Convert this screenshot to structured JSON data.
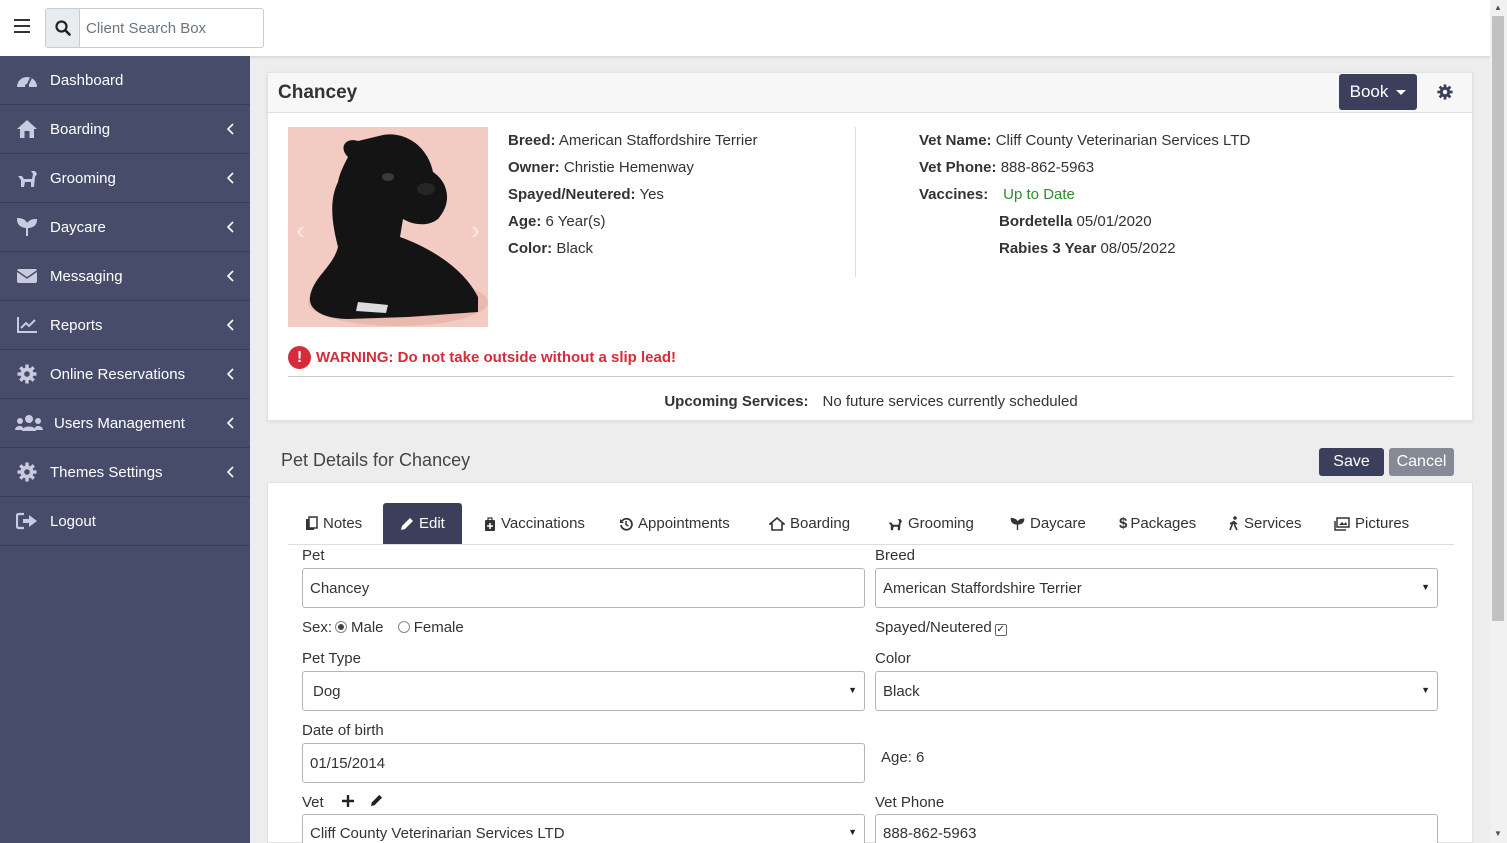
{
  "search": {
    "placeholder": "Client Search Box"
  },
  "sidebar": {
    "items": [
      {
        "label": "Dashboard",
        "icon": "dashboard-icon",
        "has_chevron": false
      },
      {
        "label": "Boarding",
        "icon": "home-icon",
        "has_chevron": true
      },
      {
        "label": "Grooming",
        "icon": "dog-icon",
        "has_chevron": true
      },
      {
        "label": "Daycare",
        "icon": "seedling-icon",
        "has_chevron": true
      },
      {
        "label": "Messaging",
        "icon": "envelope-icon",
        "has_chevron": true
      },
      {
        "label": "Reports",
        "icon": "chart-line-icon",
        "has_chevron": true
      },
      {
        "label": "Online Reservations",
        "icon": "gear-icon",
        "has_chevron": true
      },
      {
        "label": "Users Management",
        "icon": "users-icon",
        "has_chevron": true
      },
      {
        "label": "Themes Settings",
        "icon": "gear-icon",
        "has_chevron": true
      },
      {
        "label": "Logout",
        "icon": "sign-out-icon",
        "has_chevron": false
      }
    ]
  },
  "pet_card": {
    "name": "Chancey",
    "book_label": "Book",
    "breed_label": "Breed:",
    "breed": "American Staffordshire Terrier",
    "owner_label": "Owner:",
    "owner": "Christie Hemenway",
    "spayed_label": "Spayed/Neutered:",
    "spayed": "Yes",
    "age_label": "Age:",
    "age": "6 Year(s)",
    "color_label": "Color:",
    "color": "Black",
    "vet_name_label": "Vet Name:",
    "vet_name": "Cliff County Veterinarian Services LTD",
    "vet_phone_label": "Vet Phone:",
    "vet_phone": "888-862-5963",
    "vaccines_label": "Vaccines:",
    "vaccines_status": "Up to Date",
    "vaccines": [
      {
        "name": "Bordetella",
        "date": "05/01/2020"
      },
      {
        "name": "Rabies 3 Year",
        "date": "08/05/2022"
      }
    ],
    "warning": "WARNING: Do not take outside without a slip lead!",
    "upcoming_label": "Upcoming Services:",
    "upcoming_value": "No future services currently scheduled"
  },
  "details": {
    "title": "Pet Details for Chancey",
    "save_label": "Save",
    "cancel_label": "Cancel",
    "tabs": [
      {
        "label": "Notes",
        "icon": "notes-icon"
      },
      {
        "label": "Edit",
        "icon": "pencil-icon"
      },
      {
        "label": "Vaccinations",
        "icon": "medkit-icon"
      },
      {
        "label": "Appointments",
        "icon": "history-icon"
      },
      {
        "label": "Boarding",
        "icon": "home-icon"
      },
      {
        "label": "Grooming",
        "icon": "dog-icon"
      },
      {
        "label": "Daycare",
        "icon": "seedling-icon"
      },
      {
        "label": "Packages",
        "icon": "dollar-icon"
      },
      {
        "label": "Services",
        "icon": "walking-icon"
      },
      {
        "label": "Pictures",
        "icon": "images-icon"
      }
    ],
    "active_tab": "Edit",
    "form": {
      "pet_label": "Pet",
      "pet_value": "Chancey",
      "breed_label": "Breed",
      "breed_value": "American Staffordshire Terrier",
      "sex_label": "Sex:",
      "sex_male": "Male",
      "sex_female": "Female",
      "sex_selected": "Male",
      "spayed_label": "Spayed/Neutered",
      "spayed_checked": true,
      "pet_type_label": "Pet Type",
      "pet_type_value": "Dog",
      "color_label": "Color",
      "color_value": "Black",
      "dob_label": "Date of birth",
      "dob_value": "01/15/2014",
      "age_text": "Age: 6",
      "vet_label": "Vet",
      "vet_value": "Cliff County Veterinarian Services LTD",
      "vet_phone_label": "Vet Phone",
      "vet_phone_value": "888-862-5963"
    }
  },
  "colors": {
    "sidebar_bg": "#474c6b",
    "primary_button": "#3b3f5c",
    "secondary_button": "#858a94",
    "warning": "#d62b3a",
    "success": "#2e8b2e"
  }
}
